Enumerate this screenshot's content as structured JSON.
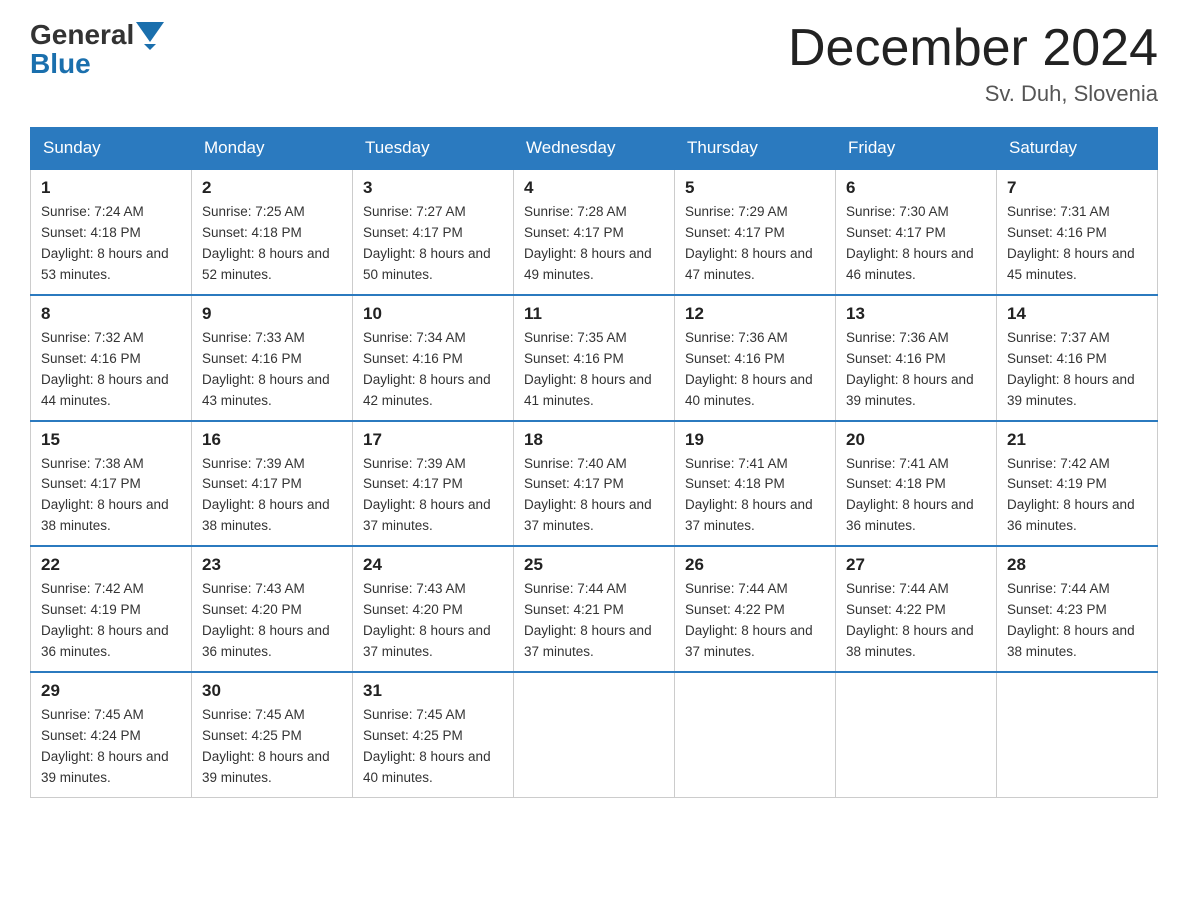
{
  "header": {
    "logo_general": "General",
    "logo_blue": "Blue",
    "month_title": "December 2024",
    "location": "Sv. Duh, Slovenia"
  },
  "weekdays": [
    "Sunday",
    "Monday",
    "Tuesday",
    "Wednesday",
    "Thursday",
    "Friday",
    "Saturday"
  ],
  "weeks": [
    [
      {
        "day": "1",
        "sunrise": "7:24 AM",
        "sunset": "4:18 PM",
        "daylight": "8 hours and 53 minutes."
      },
      {
        "day": "2",
        "sunrise": "7:25 AM",
        "sunset": "4:18 PM",
        "daylight": "8 hours and 52 minutes."
      },
      {
        "day": "3",
        "sunrise": "7:27 AM",
        "sunset": "4:17 PM",
        "daylight": "8 hours and 50 minutes."
      },
      {
        "day": "4",
        "sunrise": "7:28 AM",
        "sunset": "4:17 PM",
        "daylight": "8 hours and 49 minutes."
      },
      {
        "day": "5",
        "sunrise": "7:29 AM",
        "sunset": "4:17 PM",
        "daylight": "8 hours and 47 minutes."
      },
      {
        "day": "6",
        "sunrise": "7:30 AM",
        "sunset": "4:17 PM",
        "daylight": "8 hours and 46 minutes."
      },
      {
        "day": "7",
        "sunrise": "7:31 AM",
        "sunset": "4:16 PM",
        "daylight": "8 hours and 45 minutes."
      }
    ],
    [
      {
        "day": "8",
        "sunrise": "7:32 AM",
        "sunset": "4:16 PM",
        "daylight": "8 hours and 44 minutes."
      },
      {
        "day": "9",
        "sunrise": "7:33 AM",
        "sunset": "4:16 PM",
        "daylight": "8 hours and 43 minutes."
      },
      {
        "day": "10",
        "sunrise": "7:34 AM",
        "sunset": "4:16 PM",
        "daylight": "8 hours and 42 minutes."
      },
      {
        "day": "11",
        "sunrise": "7:35 AM",
        "sunset": "4:16 PM",
        "daylight": "8 hours and 41 minutes."
      },
      {
        "day": "12",
        "sunrise": "7:36 AM",
        "sunset": "4:16 PM",
        "daylight": "8 hours and 40 minutes."
      },
      {
        "day": "13",
        "sunrise": "7:36 AM",
        "sunset": "4:16 PM",
        "daylight": "8 hours and 39 minutes."
      },
      {
        "day": "14",
        "sunrise": "7:37 AM",
        "sunset": "4:16 PM",
        "daylight": "8 hours and 39 minutes."
      }
    ],
    [
      {
        "day": "15",
        "sunrise": "7:38 AM",
        "sunset": "4:17 PM",
        "daylight": "8 hours and 38 minutes."
      },
      {
        "day": "16",
        "sunrise": "7:39 AM",
        "sunset": "4:17 PM",
        "daylight": "8 hours and 38 minutes."
      },
      {
        "day": "17",
        "sunrise": "7:39 AM",
        "sunset": "4:17 PM",
        "daylight": "8 hours and 37 minutes."
      },
      {
        "day": "18",
        "sunrise": "7:40 AM",
        "sunset": "4:17 PM",
        "daylight": "8 hours and 37 minutes."
      },
      {
        "day": "19",
        "sunrise": "7:41 AM",
        "sunset": "4:18 PM",
        "daylight": "8 hours and 37 minutes."
      },
      {
        "day": "20",
        "sunrise": "7:41 AM",
        "sunset": "4:18 PM",
        "daylight": "8 hours and 36 minutes."
      },
      {
        "day": "21",
        "sunrise": "7:42 AM",
        "sunset": "4:19 PM",
        "daylight": "8 hours and 36 minutes."
      }
    ],
    [
      {
        "day": "22",
        "sunrise": "7:42 AM",
        "sunset": "4:19 PM",
        "daylight": "8 hours and 36 minutes."
      },
      {
        "day": "23",
        "sunrise": "7:43 AM",
        "sunset": "4:20 PM",
        "daylight": "8 hours and 36 minutes."
      },
      {
        "day": "24",
        "sunrise": "7:43 AM",
        "sunset": "4:20 PM",
        "daylight": "8 hours and 37 minutes."
      },
      {
        "day": "25",
        "sunrise": "7:44 AM",
        "sunset": "4:21 PM",
        "daylight": "8 hours and 37 minutes."
      },
      {
        "day": "26",
        "sunrise": "7:44 AM",
        "sunset": "4:22 PM",
        "daylight": "8 hours and 37 minutes."
      },
      {
        "day": "27",
        "sunrise": "7:44 AM",
        "sunset": "4:22 PM",
        "daylight": "8 hours and 38 minutes."
      },
      {
        "day": "28",
        "sunrise": "7:44 AM",
        "sunset": "4:23 PM",
        "daylight": "8 hours and 38 minutes."
      }
    ],
    [
      {
        "day": "29",
        "sunrise": "7:45 AM",
        "sunset": "4:24 PM",
        "daylight": "8 hours and 39 minutes."
      },
      {
        "day": "30",
        "sunrise": "7:45 AM",
        "sunset": "4:25 PM",
        "daylight": "8 hours and 39 minutes."
      },
      {
        "day": "31",
        "sunrise": "7:45 AM",
        "sunset": "4:25 PM",
        "daylight": "8 hours and 40 minutes."
      },
      null,
      null,
      null,
      null
    ]
  ],
  "labels": {
    "sunrise": "Sunrise:",
    "sunset": "Sunset:",
    "daylight": "Daylight:"
  }
}
